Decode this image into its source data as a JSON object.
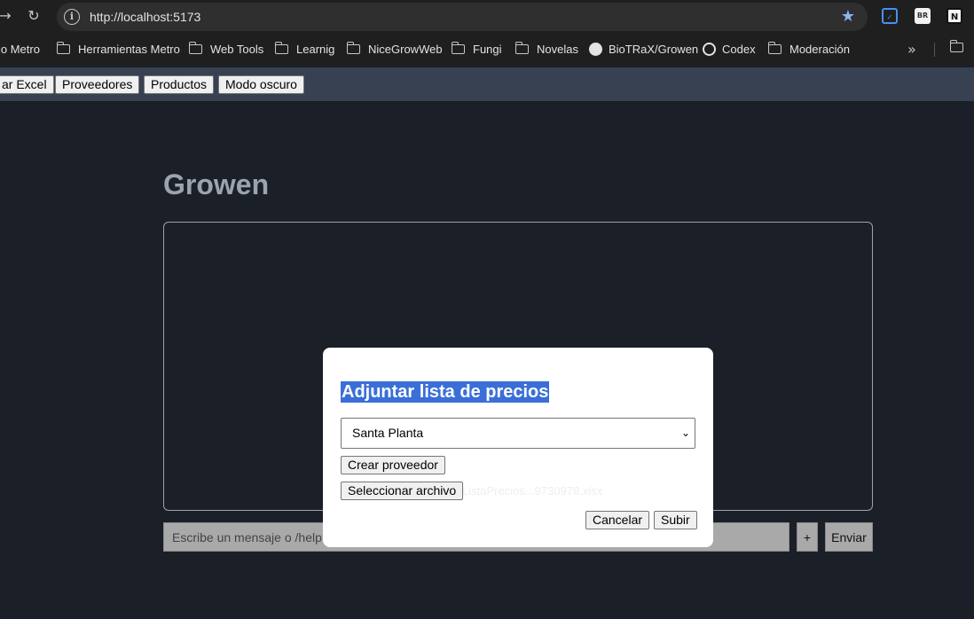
{
  "browser": {
    "url": "http://localhost:5173",
    "bookmarks": [
      {
        "label": "io Metro",
        "icon": "none"
      },
      {
        "label": "Herramientas Metro",
        "icon": "folder-icon"
      },
      {
        "label": "Web Tools",
        "icon": "folder-icon"
      },
      {
        "label": "Learnig",
        "icon": "folder-icon"
      },
      {
        "label": "NiceGrowWeb",
        "icon": "folder-icon"
      },
      {
        "label": "Fungi",
        "icon": "folder-icon"
      },
      {
        "label": "Novelas",
        "icon": "folder-icon"
      },
      {
        "label": "BioTRaX/Growen",
        "icon": "github-icon"
      },
      {
        "label": "Codex",
        "icon": "codex-icon"
      },
      {
        "label": "Moderación",
        "icon": "folder-icon"
      }
    ],
    "extensions": [
      "BR",
      "N"
    ]
  },
  "toolbar": {
    "buttons": [
      "ar Excel",
      "Proveedores",
      "Productos",
      "Modo oscuro"
    ]
  },
  "main": {
    "title": "Growen",
    "input_placeholder": "Escribe un mensaje o /help",
    "plus_label": "+",
    "send_label": "Enviar"
  },
  "modal": {
    "title": "Adjuntar lista de precios",
    "selected_provider": "Santa Planta",
    "create_provider_label": "Crear proveedor",
    "select_file_label": "Seleccionar archivo",
    "file_name": "ListaPrecios...9730978.xlsx",
    "cancel_label": "Cancelar",
    "submit_label": "Subir"
  },
  "colors": {
    "page_bg": "#1b1f27",
    "toolbar_bg": "#374151",
    "highlight": "#3a6fd8",
    "star": "#8ab4f8"
  }
}
